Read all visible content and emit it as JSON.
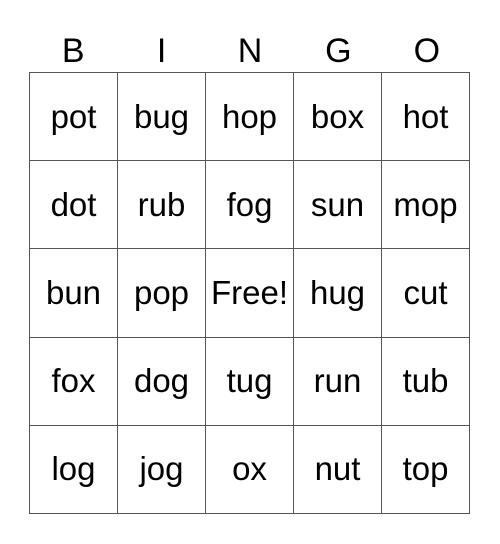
{
  "header": [
    "B",
    "I",
    "N",
    "G",
    "O"
  ],
  "cells": [
    [
      "pot",
      "bug",
      "hop",
      "box",
      "hot"
    ],
    [
      "dot",
      "rub",
      "fog",
      "sun",
      "mop"
    ],
    [
      "bun",
      "pop",
      "Free!",
      "hug",
      "cut"
    ],
    [
      "fox",
      "dog",
      "tug",
      "run",
      "tub"
    ],
    [
      "log",
      "jog",
      "ox",
      "nut",
      "top"
    ]
  ]
}
